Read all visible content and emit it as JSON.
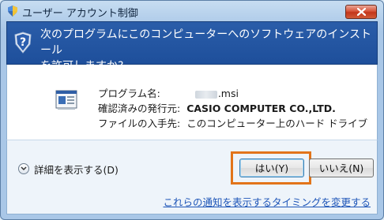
{
  "window": {
    "title": "ユーザー アカウント制御"
  },
  "header": {
    "question_line1": "次のプログラムにこのコンピューターへのソフトウェアのインストール",
    "question_line2": "を許可しますか?"
  },
  "info": {
    "program_label": "プログラム名:",
    "program_value": ".msi",
    "publisher_label": "確認済みの発行元:",
    "publisher_value": "CASIO COMPUTER CO.,LTD.",
    "source_label": "ファイルの入手先:",
    "source_value": "このコンピューター上のハード ドライブ"
  },
  "footer": {
    "details_label": "詳細を表示する(D)",
    "yes_label": "はい(Y)",
    "no_label": "いいえ(N)",
    "notify_link": "これらの通知を表示するタイミングを変更する"
  },
  "colors": {
    "header_bg": "#1e4f9b",
    "highlight": "#e2741a",
    "link": "#1f56b8"
  }
}
